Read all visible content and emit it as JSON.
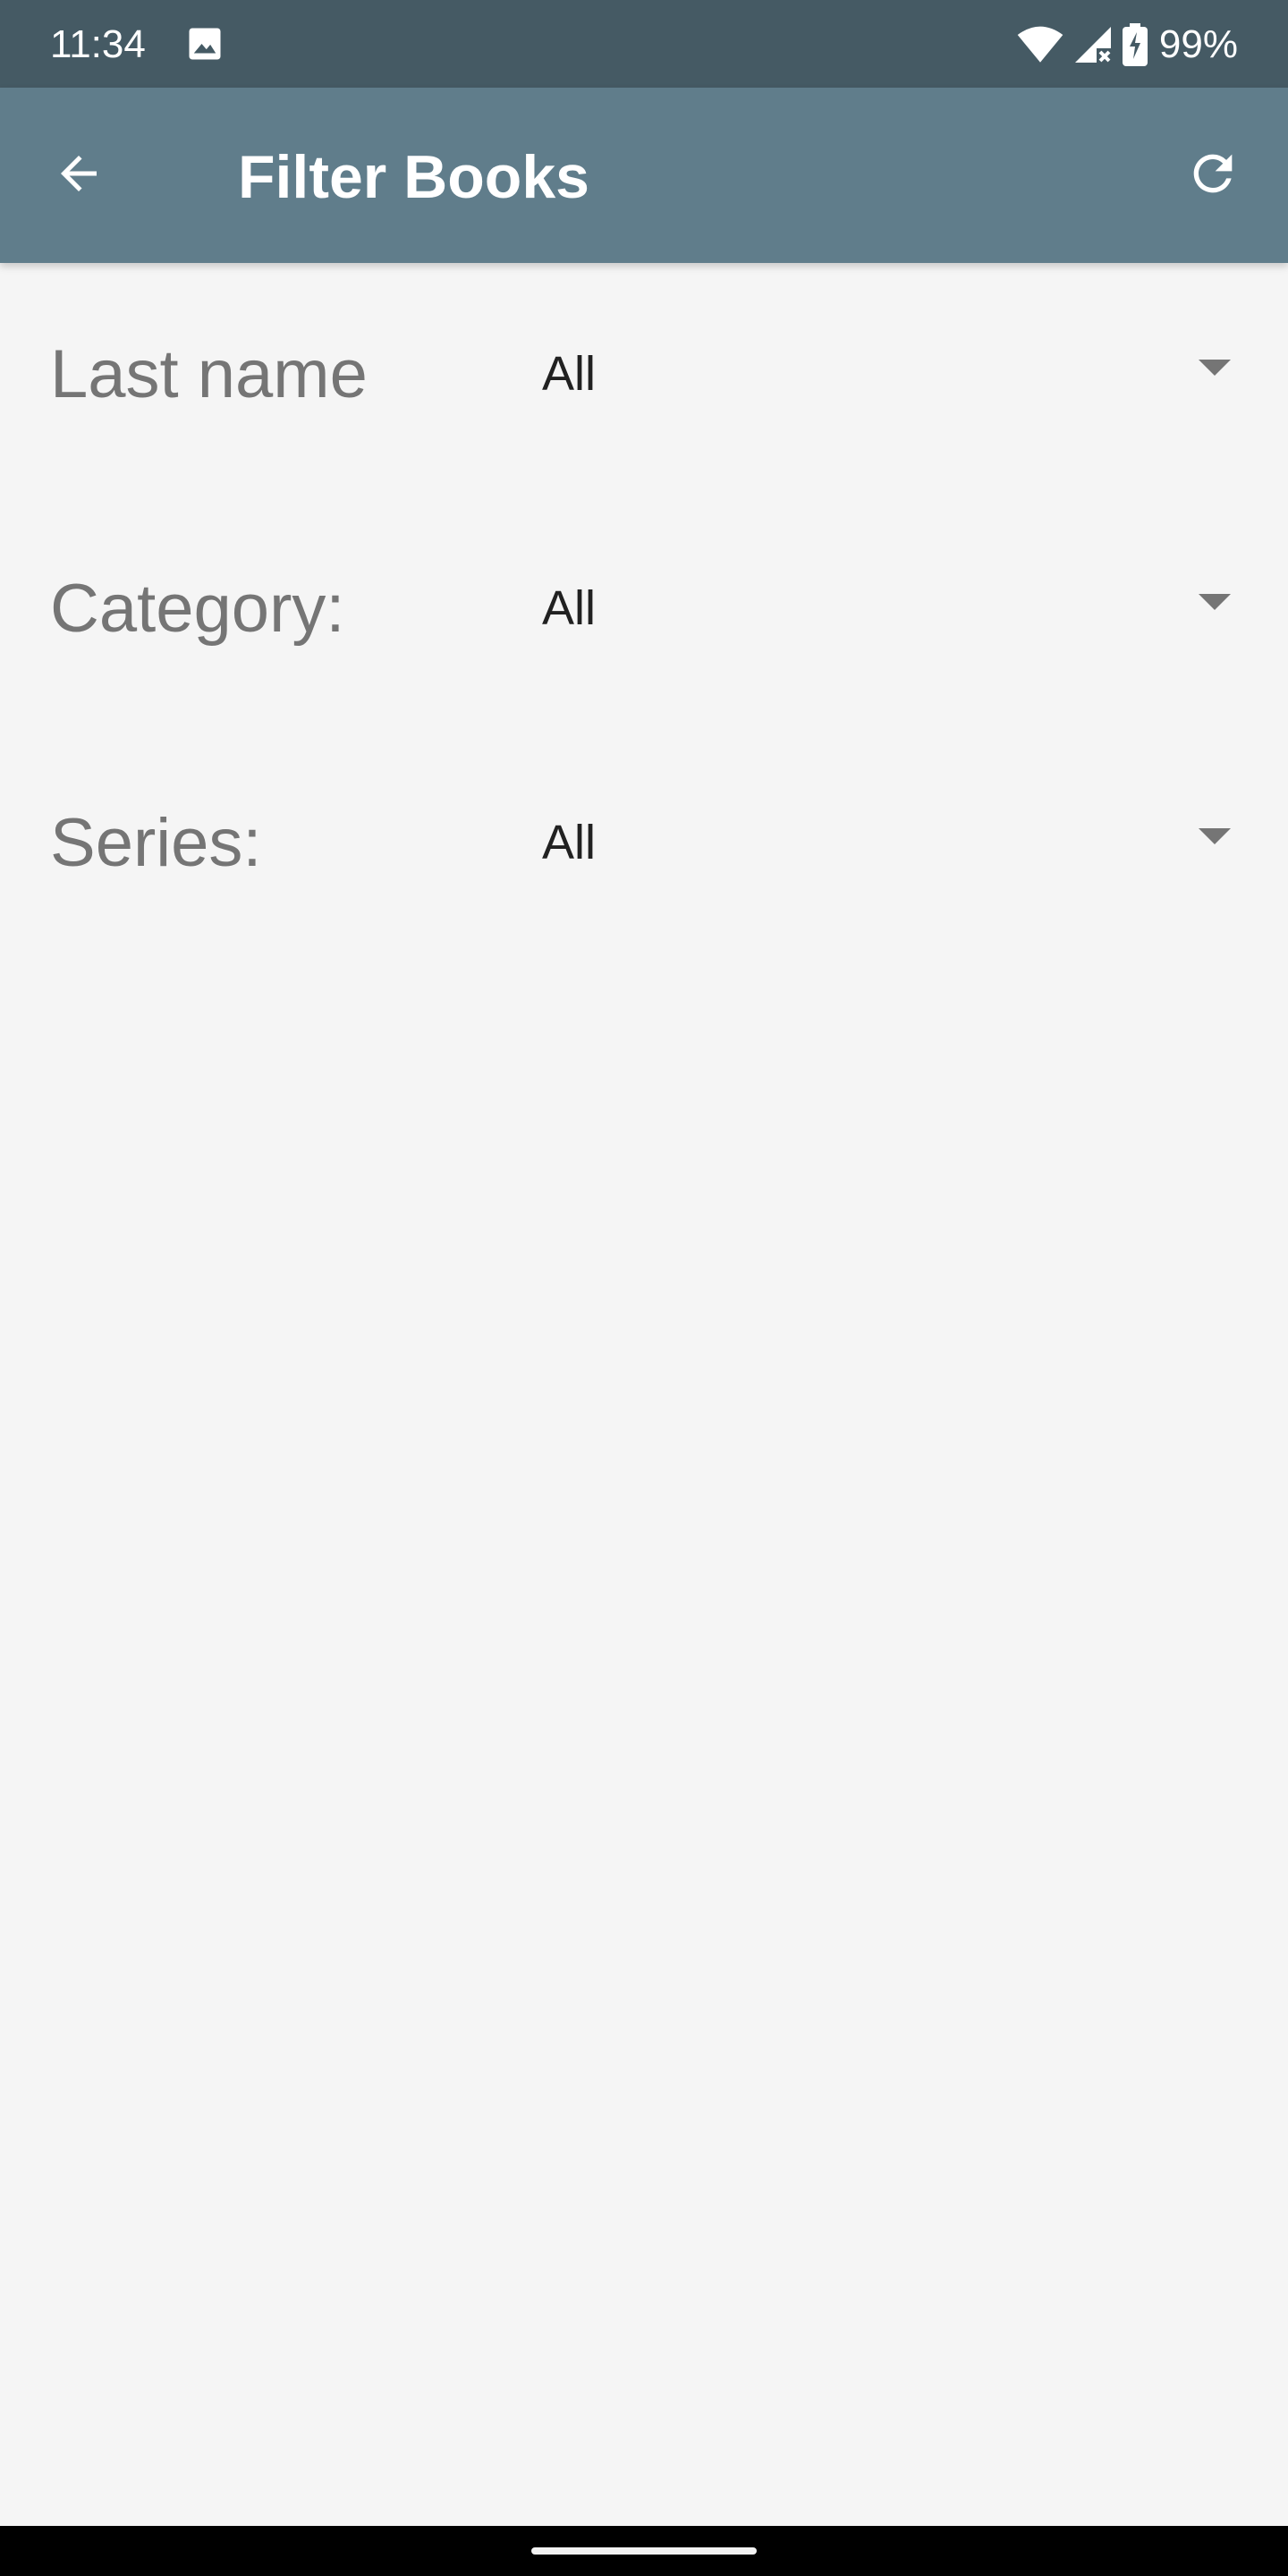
{
  "status_bar": {
    "time": "11:34",
    "battery": "99%",
    "icons": [
      "image-icon",
      "wifi-icon",
      "cell-signal-icon",
      "battery-charging-icon"
    ]
  },
  "app_bar": {
    "title": "Filter Books",
    "back_icon": "arrow-back-icon",
    "refresh_icon": "refresh-icon"
  },
  "filters": [
    {
      "label": "Last name",
      "value": "All"
    },
    {
      "label": "Category:",
      "value": "All"
    },
    {
      "label": "Series:",
      "value": "All"
    }
  ],
  "colors": {
    "status_bar": "#455a64",
    "app_bar": "#607d8b",
    "background": "#f5f5f5",
    "label_text": "#757575",
    "value_text": "#212121",
    "icon_white": "#ffffff"
  }
}
